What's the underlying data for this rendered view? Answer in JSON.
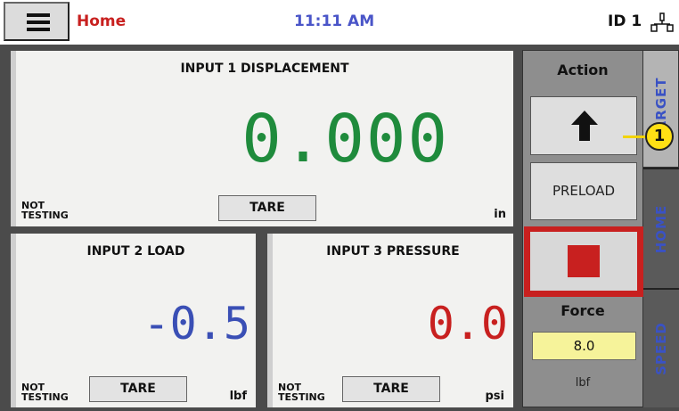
{
  "header": {
    "title": "Home",
    "time": "11:11 AM",
    "id_label": "ID 1",
    "icons": {
      "menu": "hamburger-menu-icon",
      "network": "network-icon"
    }
  },
  "panels": [
    {
      "title": "INPUT 1 DISPLACEMENT",
      "value": "0.000",
      "status": "NOT TESTING",
      "tare_label": "TARE",
      "unit": "in",
      "value_color": "#1f8b3c"
    },
    {
      "title": "INPUT 2 LOAD",
      "value": "-0.5",
      "status": "NOT TESTING",
      "tare_label": "TARE",
      "unit": "lbf",
      "value_color": "#3a4fb5"
    },
    {
      "title": "INPUT 3 PRESSURE",
      "value": "0.0",
      "status": "NOT TESTING",
      "tare_label": "TARE",
      "unit": "psi",
      "value_color": "#c8201f"
    }
  ],
  "controls": {
    "action_label": "Action",
    "preload_label": "PRELOAD",
    "force_label": "Force",
    "force_value": "8.0",
    "force_unit": "lbf",
    "icons": {
      "up": "up-arrow-icon",
      "stop": "stop-icon"
    }
  },
  "tabs": [
    {
      "label": "TARGET",
      "active": true
    },
    {
      "label": "HOME",
      "active": false
    },
    {
      "label": "SPEED",
      "active": false
    }
  ],
  "callout": {
    "number": "1"
  },
  "colors": {
    "accent_red": "#c8201f",
    "clock_blue": "#4a55c8",
    "highlight_yellow": "#ffe014"
  }
}
